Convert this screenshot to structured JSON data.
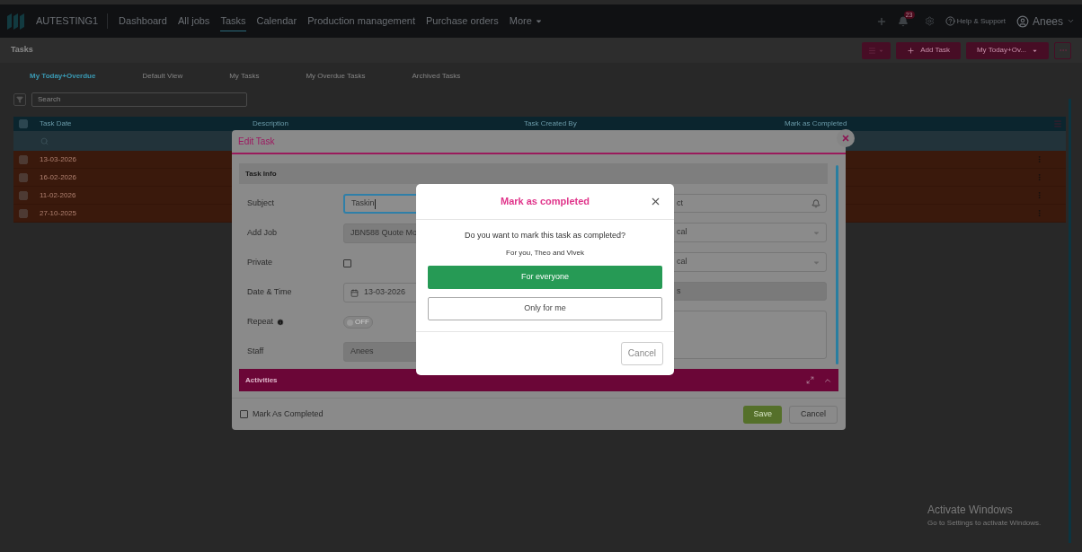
{
  "nav": {
    "brand": "AUTESTING1",
    "links": [
      {
        "label": "Dashboard",
        "selected": false
      },
      {
        "label": "All jobs",
        "selected": false
      },
      {
        "label": "Tasks",
        "selected": true
      },
      {
        "label": "Calendar",
        "selected": false
      },
      {
        "label": "Production management",
        "selected": false
      },
      {
        "label": "Purchase orders",
        "selected": false
      }
    ],
    "more": "More",
    "notification_count": "23",
    "help": "Help & Support",
    "user": "Anees"
  },
  "page": {
    "title": "Tasks",
    "add_button": "Add Task",
    "view_select": "My Today+Ov...",
    "tabs": [
      {
        "label": "My Today+Overdue",
        "selected": true
      },
      {
        "label": "Default View",
        "selected": false
      },
      {
        "label": "My Tasks",
        "selected": false
      },
      {
        "label": "My Overdue Tasks",
        "selected": false
      },
      {
        "label": "Archived Tasks",
        "selected": false
      }
    ],
    "search": {
      "placeholder": "Search"
    }
  },
  "table": {
    "all_checked": false,
    "columns": [
      "Task Date",
      "Description",
      "Task Created By",
      "Mark as Completed"
    ],
    "rows": [
      {
        "task_date": "13-03-2026",
        "checked": false
      },
      {
        "task_date": "16-02-2026",
        "checked": false
      },
      {
        "task_date": "11-02-2026",
        "checked": false
      },
      {
        "task_date": "27-10-2025",
        "checked": false
      }
    ]
  },
  "edit_task": {
    "title": "Edit Task",
    "section": "Task Info",
    "fields": [
      {
        "label": "Subject",
        "kind": "text",
        "value": "Taskin"
      },
      {
        "label": "Add Job",
        "kind": "text",
        "value": "JBN588 Quote Mo"
      },
      {
        "label": "Private",
        "kind": "checkbox",
        "checked": false
      },
      {
        "label": "Date & Time",
        "kind": "date",
        "value": "13-03-2026"
      },
      {
        "label": "Repeat",
        "kind": "toggle",
        "on": false,
        "value": "OFF"
      },
      {
        "label": "Staff",
        "kind": "readonly",
        "value": "Anees"
      }
    ],
    "right_fields": [
      {
        "kind": "bell",
        "value": "ct"
      },
      {
        "kind": "select",
        "value": "cal"
      },
      {
        "kind": "select",
        "value": "cal"
      },
      {
        "kind": "readonly",
        "value": "s"
      },
      {
        "kind": "textarea"
      }
    ],
    "activities": "Activities",
    "mark_completed": {
      "label": "Mark As Completed",
      "checked": false
    },
    "save": "Save",
    "cancel": "Cancel"
  },
  "confirm": {
    "title": "Mark as completed",
    "question": "Do you want to mark this task as completed?",
    "detail": "For you, Theo and Vivek",
    "primary": "For everyone",
    "secondary": "Only for me",
    "cancel": "Cancel"
  },
  "os_notice": {
    "title": "Activate Windows",
    "detail": "Go to Settings to activate Windows."
  }
}
